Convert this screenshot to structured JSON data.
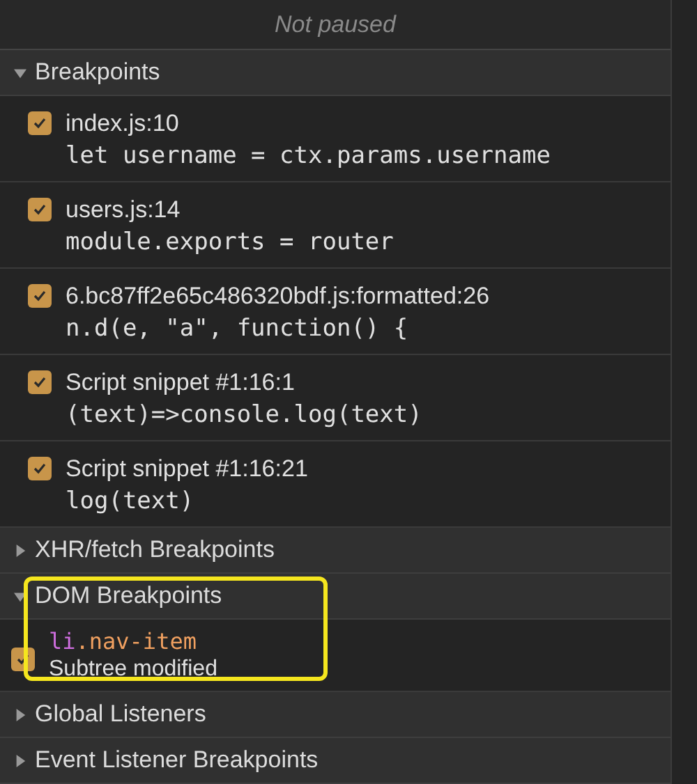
{
  "status": "Not paused",
  "sections": [
    {
      "title": "Breakpoints",
      "expanded": true,
      "kind": "code",
      "items": [
        {
          "location": "index.js:10",
          "code": "let username = ctx.params.username",
          "checked": true
        },
        {
          "location": "users.js:14",
          "code": "module.exports = router",
          "checked": true
        },
        {
          "location": "6.bc87ff2e65c486320bdf.js:formatted:26",
          "code": "n.d(e, \"a\", function() {",
          "checked": true
        },
        {
          "location": "Script snippet #1:16:1",
          "code": "(text)=>console.log(text)",
          "checked": true
        },
        {
          "location": "Script snippet #1:16:21",
          "code": "log(text)",
          "checked": true
        }
      ]
    },
    {
      "title": "XHR/fetch Breakpoints",
      "expanded": false
    },
    {
      "title": "DOM Breakpoints",
      "expanded": true,
      "kind": "dom",
      "highlighted": true,
      "items": [
        {
          "tag": "li",
          "selector": ".nav-item",
          "type": "Subtree modified",
          "checked": true
        }
      ]
    },
    {
      "title": "Global Listeners",
      "expanded": false
    },
    {
      "title": "Event Listener Breakpoints",
      "expanded": false
    }
  ]
}
